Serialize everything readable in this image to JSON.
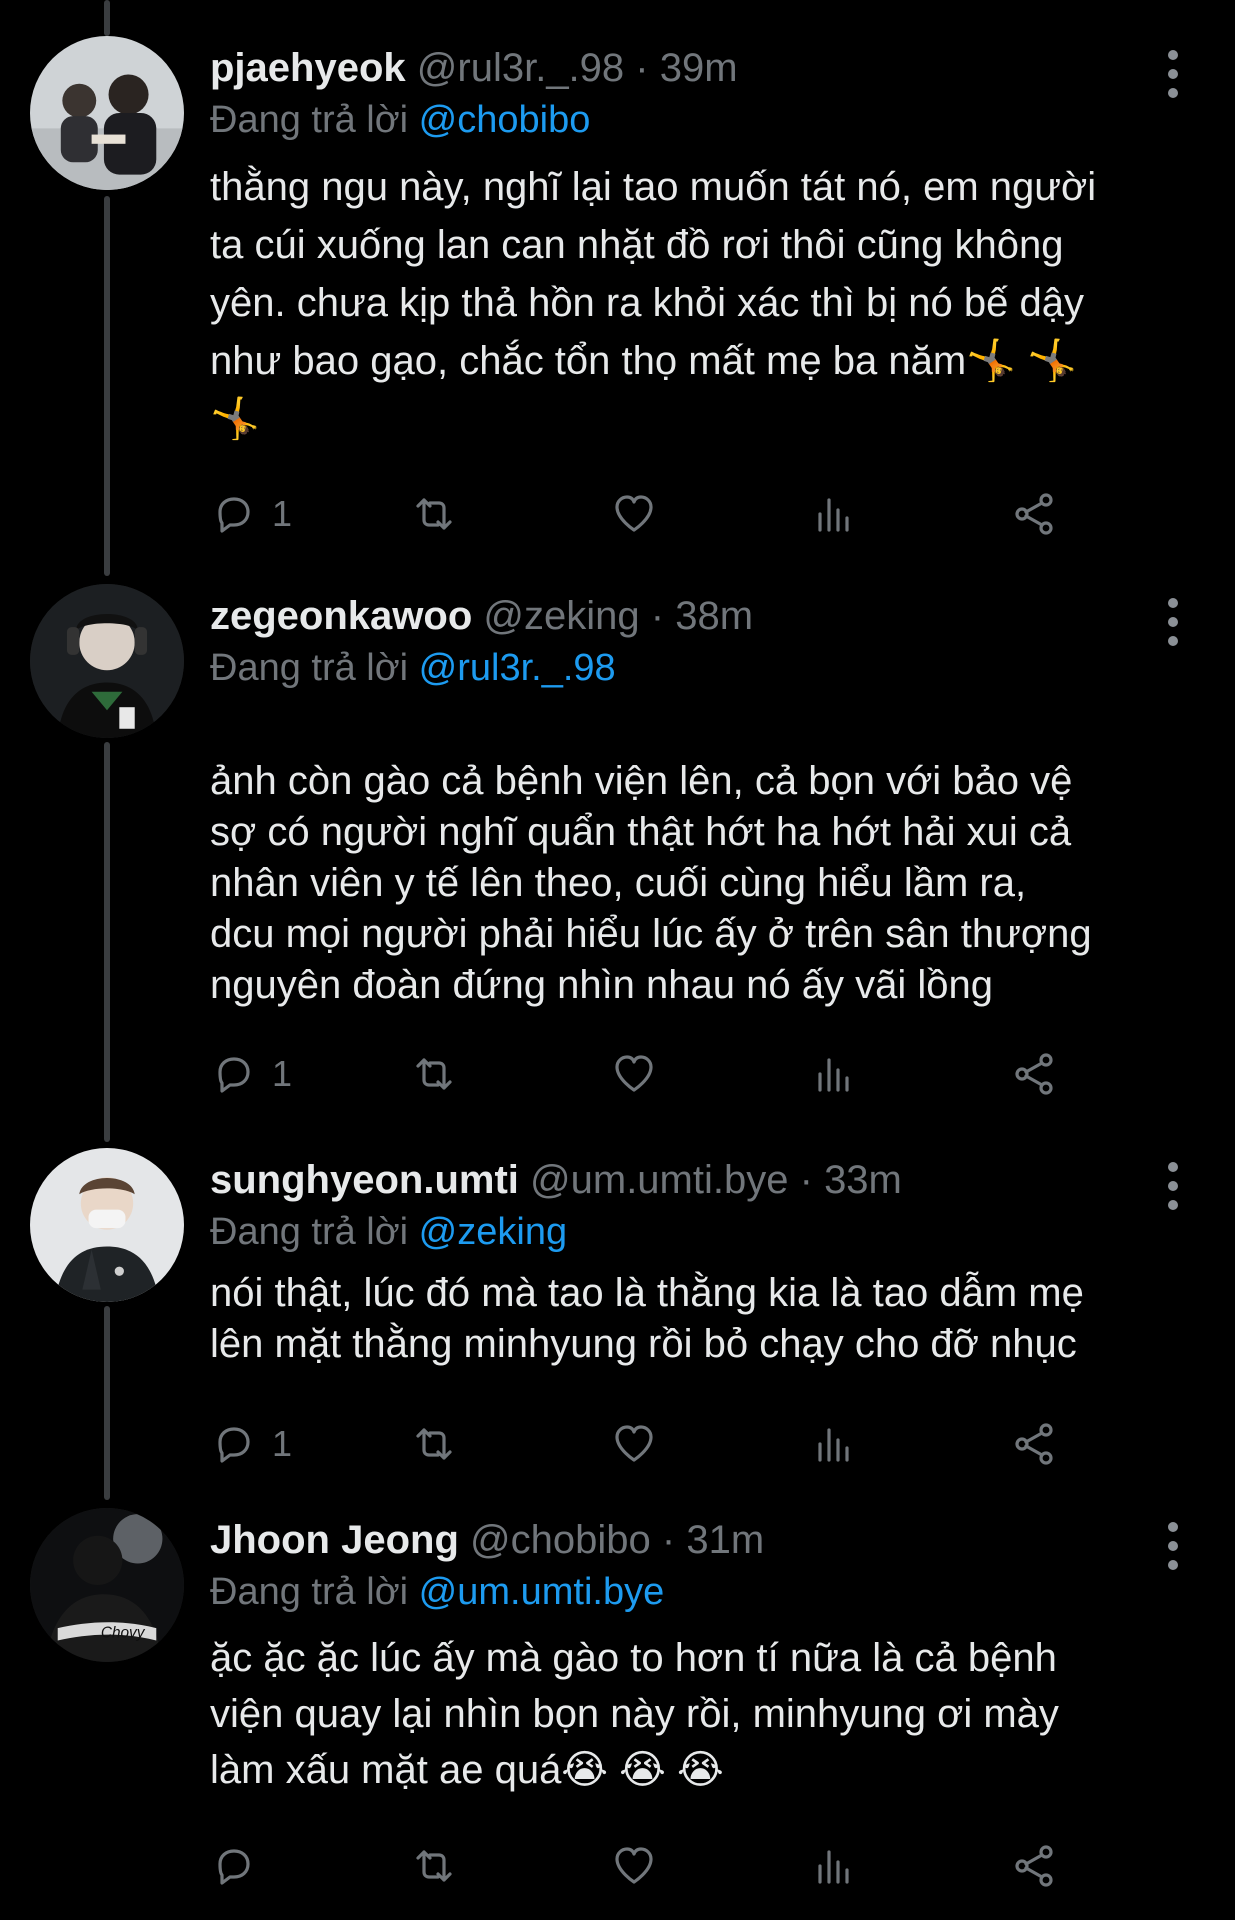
{
  "reply_prefix": "Đang trả lời",
  "tweets": [
    {
      "name": "pjaehyeok",
      "handle": "@rul3r._.98",
      "sep": "·",
      "time": "39m",
      "reply_to": "@chobibo",
      "text": "thằng ngu này, nghĩ lại tao muốn tát nó, em người\nta cúi xuống lan can nhặt đồ rơi thôi cũng không\nyên. chưa kịp thả hồn ra khỏi xác thì bị nó bế dậy\nnhư bao gạo, chắc tổn thọ mất mẹ ba năm🤸 🤸\n🤸",
      "reply_count": "1"
    },
    {
      "name": "zegeonkawoo",
      "handle": "@zeking",
      "sep": "·",
      "time": "38m",
      "reply_to": "@rul3r._.98",
      "text": "ảnh còn gào cả bệnh viện lên, cả bọn với bảo vệ\nsợ có người nghĩ quẩn thật hớt ha hớt hải xui cả\nnhân viên y tế lên theo, cuối cùng hiểu lầm ra,\ndcu mọi người phải hiểu lúc ấy ở trên sân thượng\nnguyên đoàn đứng nhìn nhau nó ấy vãi lồng",
      "reply_count": "1"
    },
    {
      "name": "sunghyeon.umti",
      "handle": "@um.umti.bye",
      "sep": "·",
      "time": "33m",
      "reply_to": "@zeking",
      "text": "nói thật, lúc đó mà tao là thằng kia là tao dẫm mẹ\nlên mặt thằng minhyung rồi bỏ chạy cho đỡ nhục",
      "reply_count": "1"
    },
    {
      "name": "Jhoon Jeong",
      "handle": "@chobibo",
      "sep": "·",
      "time": "31m",
      "reply_to": "@um.umti.bye",
      "text": "ặc ặc ặc lúc ấy mà gào to hơn tí nữa là cả bệnh\nviện quay lại nhìn bọn này rồi, minhyung ơi mày\nlàm xấu mặt ae quá😭 😭 😭",
      "reply_count": ""
    }
  ],
  "icons": {
    "reply": "reply-icon",
    "retweet": "retweet-icon",
    "like": "heart-icon",
    "views": "views-icon",
    "share": "share-icon",
    "more": "more-icon"
  },
  "colors": {
    "background": "#000000",
    "text": "#e7e9ea",
    "muted": "#71767b",
    "mention": "#1d9bf0",
    "thread_line": "#3a3d40"
  }
}
